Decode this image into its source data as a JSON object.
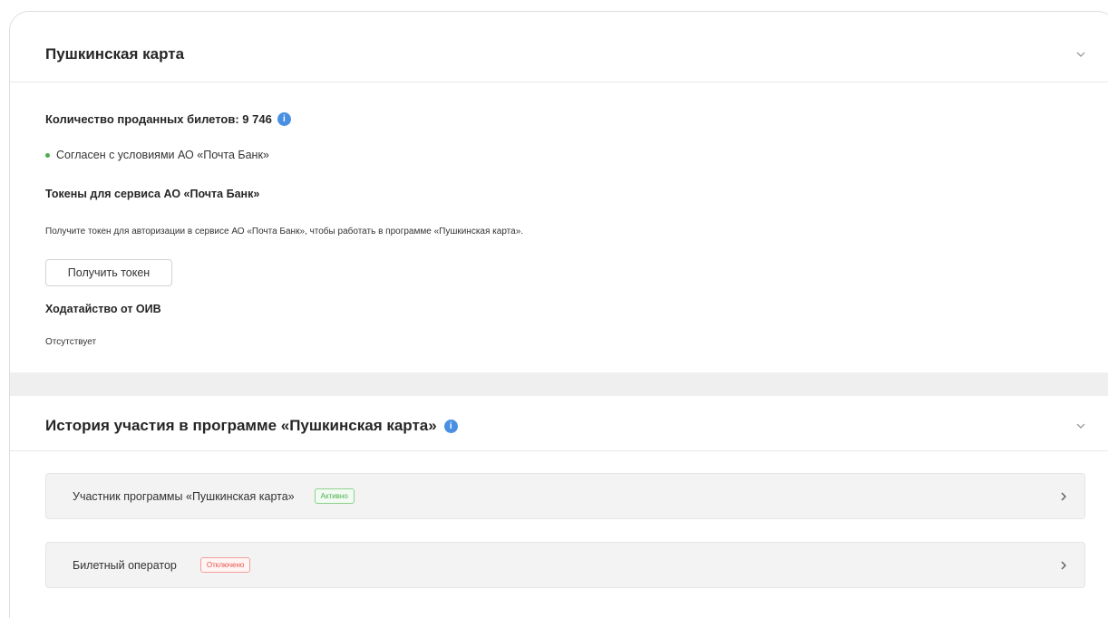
{
  "pushkin_card": {
    "title": "Пушкинская карта",
    "sold_tickets": "Количество проданных билетов: 9 746",
    "agreement": "Согласен с условиями АО «Почта Банк»",
    "tokens_title": "Токены для сервиса АО «Почта Банк»",
    "tokens_description": "Получите токен для авторизации в сервисе АО «Почта Банк», чтобы работать в программе «Пушкинская карта».",
    "get_token_button": "Получить токен",
    "petition_title": "Ходатайство от ОИВ",
    "petition_value": "Отсутствует"
  },
  "history": {
    "title": "История участия в программе «Пушкинская карта»",
    "rows": [
      {
        "label": "Участник программы «Пушкинская карта»",
        "status": "Активно",
        "status_color": "#4caf50"
      },
      {
        "label": "Билетный оператор",
        "status": "Отключено",
        "status_color": "#e5534b"
      }
    ]
  },
  "colors": {
    "info_icon": "#4a90e2",
    "agreement_dot": "#4caf50"
  },
  "icons": {
    "collapse": "chevron-down-icon",
    "row_open": "chevron-right-icon",
    "info": "info-icon"
  }
}
